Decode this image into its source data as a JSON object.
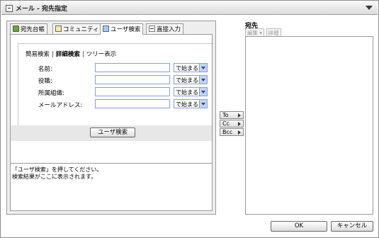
{
  "window": {
    "title": "メール - 宛先指定"
  },
  "tabs": [
    {
      "label": "宛先台帳",
      "icon": "address-book-icon"
    },
    {
      "label": "コミュニティ",
      "icon": "community-icon"
    },
    {
      "label": "ユーザ検索",
      "icon": "user-search-icon"
    },
    {
      "label": "直接入力",
      "icon": "direct-input-icon"
    }
  ],
  "search": {
    "modes": {
      "simple": "簡易検索",
      "detail": "詳細検索",
      "tree": "ツリー表示",
      "separator": "|"
    },
    "fields": [
      {
        "label": "名前:",
        "value": "",
        "match": "で始まる"
      },
      {
        "label": "役職:",
        "value": "",
        "match": "で始まる"
      },
      {
        "label": "所属組織:",
        "value": "",
        "match": "で始まる"
      },
      {
        "label": "メールアドレス:",
        "value": "",
        "match": "で始まる"
      }
    ],
    "button_label": "ユーザ検索",
    "result_lines": [
      "「ユーザ検索」を押してください。",
      "検索結果がここに表示されます。"
    ]
  },
  "transfer": {
    "to_label": "To",
    "cc_label": "Cc",
    "bcc_label": "Bcc"
  },
  "recipients": {
    "header": "宛先",
    "edit_label": "編集 ▾",
    "detail_label": "詳細",
    "items": []
  },
  "footer": {
    "ok_label": "OK",
    "cancel_label": "キャンセル"
  }
}
